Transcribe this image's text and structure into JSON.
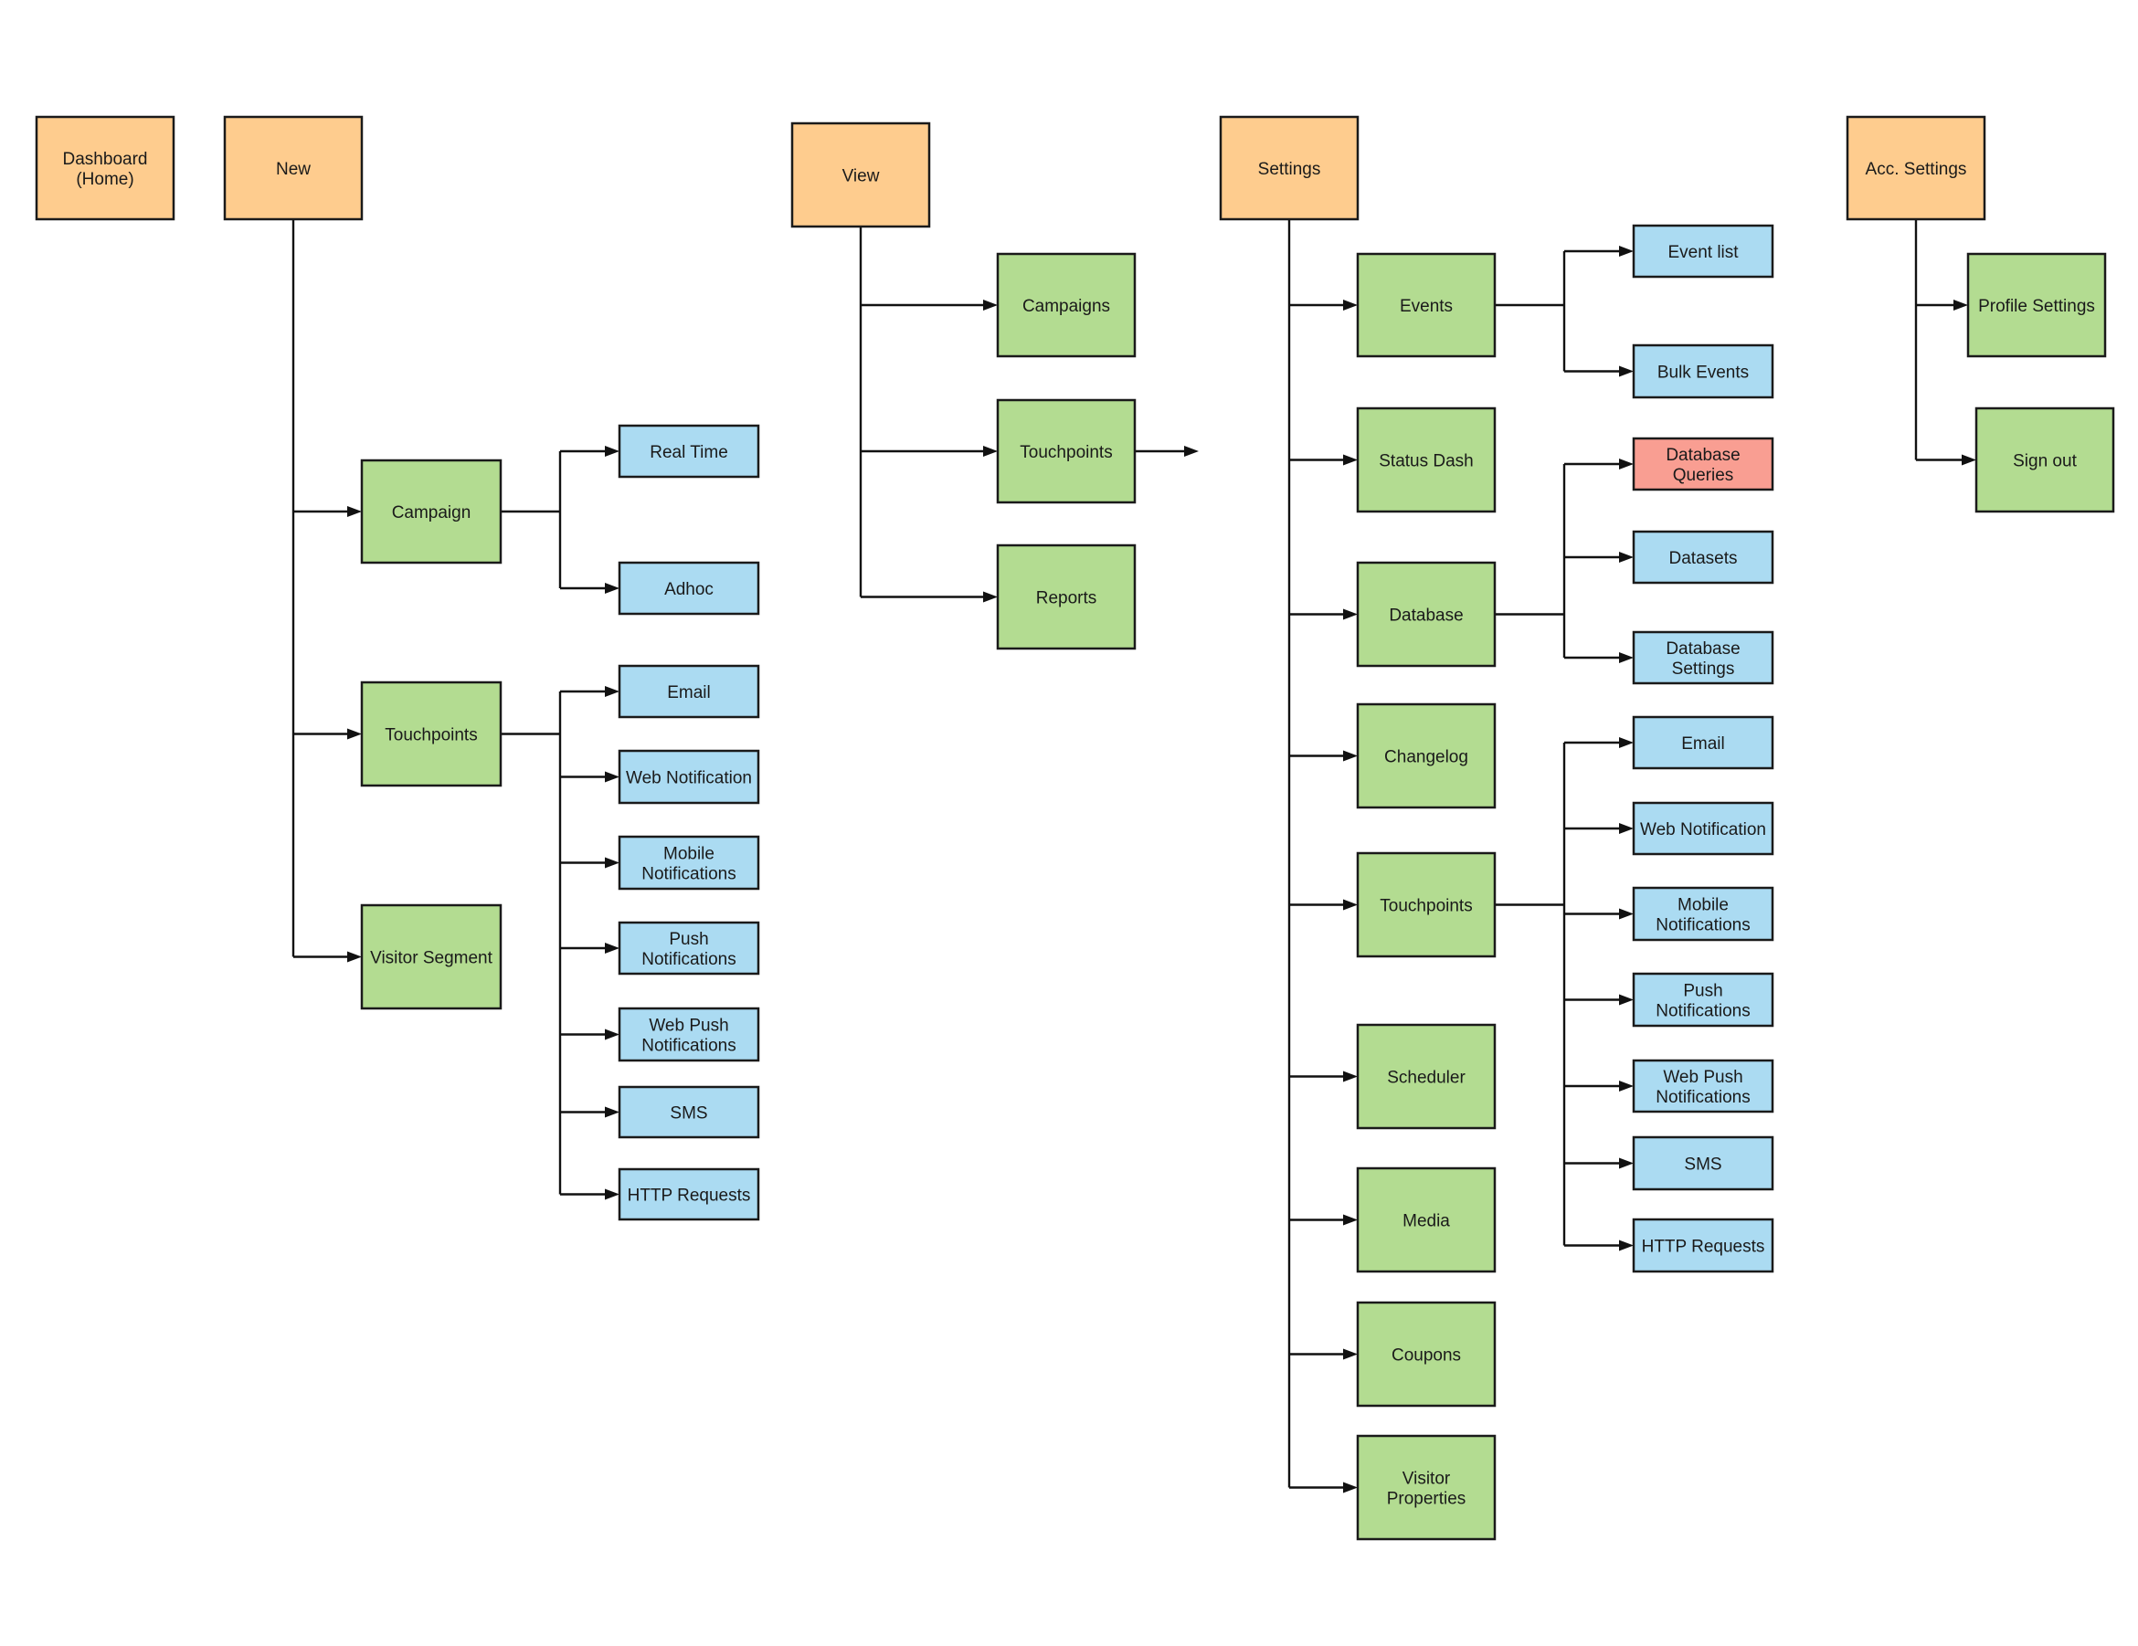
{
  "diagram": {
    "type": "sitemap-tree",
    "colors": {
      "top_level": "#FECC8E",
      "second_level": "#B3DC91",
      "third_level": "#ABDBF2",
      "highlight": "#F99E92",
      "stroke": "#1A1A1A"
    },
    "roots": [
      {
        "id": "dashboard",
        "label": "Dashboard\n(Home)",
        "level": "top_level",
        "children": []
      },
      {
        "id": "new",
        "label": "New",
        "level": "top_level",
        "children": [
          {
            "id": "new-campaign",
            "label": "Campaign",
            "level": "second_level",
            "children": [
              {
                "id": "new-campaign-realtime",
                "label": "Real Time",
                "level": "third_level"
              },
              {
                "id": "new-campaign-adhoc",
                "label": "Adhoc",
                "level": "third_level"
              }
            ]
          },
          {
            "id": "new-touchpoints",
            "label": "Touchpoints",
            "level": "second_level",
            "children": [
              {
                "id": "new-tp-email",
                "label": "Email",
                "level": "third_level"
              },
              {
                "id": "new-tp-webnotif",
                "label": "Web Notification",
                "level": "third_level"
              },
              {
                "id": "new-tp-mobile",
                "label": "Mobile\nNotifications",
                "level": "third_level"
              },
              {
                "id": "new-tp-push",
                "label": "Push\nNotifications",
                "level": "third_level"
              },
              {
                "id": "new-tp-webpush",
                "label": "Web Push\nNotifications",
                "level": "third_level"
              },
              {
                "id": "new-tp-sms",
                "label": "SMS",
                "level": "third_level"
              },
              {
                "id": "new-tp-http",
                "label": "HTTP Requests",
                "level": "third_level"
              }
            ]
          },
          {
            "id": "new-visitor-segment",
            "label": "Visitor Segment",
            "level": "second_level",
            "children": []
          }
        ]
      },
      {
        "id": "view",
        "label": "View",
        "level": "top_level",
        "children": [
          {
            "id": "view-campaigns",
            "label": "Campaigns",
            "level": "second_level",
            "children": []
          },
          {
            "id": "view-touchpoints",
            "label": "Touchpoints",
            "level": "second_level",
            "children": [],
            "dangling_arrow": true
          },
          {
            "id": "view-reports",
            "label": "Reports",
            "level": "second_level",
            "children": []
          }
        ]
      },
      {
        "id": "settings",
        "label": "Settings",
        "level": "top_level",
        "children": [
          {
            "id": "set-events",
            "label": "Events",
            "level": "second_level",
            "children": [
              {
                "id": "set-events-list",
                "label": "Event list",
                "level": "third_level"
              },
              {
                "id": "set-events-bulk",
                "label": "Bulk Events",
                "level": "third_level"
              }
            ]
          },
          {
            "id": "set-status-dash",
            "label": "Status Dash",
            "level": "second_level",
            "children": []
          },
          {
            "id": "set-database",
            "label": "Database",
            "level": "second_level",
            "children": [
              {
                "id": "set-db-queries",
                "label": "Database\nQueries",
                "level": "highlight"
              },
              {
                "id": "set-db-datasets",
                "label": "Datasets",
                "level": "third_level"
              },
              {
                "id": "set-db-settings",
                "label": "Database\nSettings",
                "level": "third_level"
              }
            ]
          },
          {
            "id": "set-changelog",
            "label": "Changelog",
            "level": "second_level",
            "children": []
          },
          {
            "id": "set-touchpoints",
            "label": "Touchpoints",
            "level": "second_level",
            "children": [
              {
                "id": "set-tp-email",
                "label": "Email",
                "level": "third_level"
              },
              {
                "id": "set-tp-webnotif",
                "label": "Web Notification",
                "level": "third_level"
              },
              {
                "id": "set-tp-mobile",
                "label": "Mobile\nNotifications",
                "level": "third_level"
              },
              {
                "id": "set-tp-push",
                "label": "Push\nNotifications",
                "level": "third_level"
              },
              {
                "id": "set-tp-webpush",
                "label": "Web Push\nNotifications",
                "level": "third_level"
              },
              {
                "id": "set-tp-sms",
                "label": "SMS",
                "level": "third_level"
              },
              {
                "id": "set-tp-http",
                "label": "HTTP Requests",
                "level": "third_level"
              }
            ]
          },
          {
            "id": "set-scheduler",
            "label": "Scheduler",
            "level": "second_level",
            "children": []
          },
          {
            "id": "set-media",
            "label": "Media",
            "level": "second_level",
            "children": []
          },
          {
            "id": "set-coupons",
            "label": "Coupons",
            "level": "second_level",
            "children": []
          },
          {
            "id": "set-visitor-props",
            "label": "Visitor\nProperties",
            "level": "second_level",
            "children": []
          }
        ]
      },
      {
        "id": "acc-settings",
        "label": "Acc. Settings",
        "level": "top_level",
        "children": [
          {
            "id": "acc-profile",
            "label": "Profile Settings",
            "level": "second_level",
            "children": []
          },
          {
            "id": "acc-signout",
            "label": "Sign out",
            "level": "second_level",
            "children": []
          }
        ]
      }
    ]
  }
}
